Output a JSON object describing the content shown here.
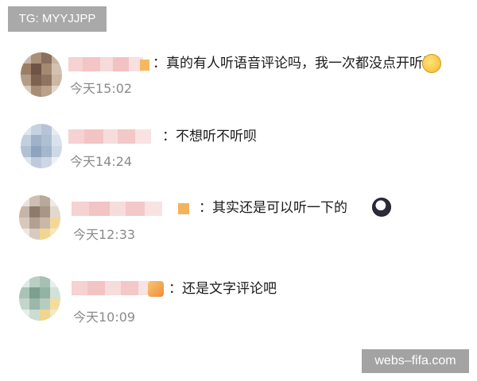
{
  "tag": {
    "text": "TG: MYYJJPP"
  },
  "watermark": {
    "text": "webs–fifa.com"
  },
  "comments": [
    {
      "text": "：真的有人听语音评论吗，我一次都没点开听过",
      "time": "今天15:02",
      "emoji": "laughing-crying-emoji-icon"
    },
    {
      "text": "：不想听不听呗",
      "time": "今天14:24",
      "emoji": ""
    },
    {
      "text": "：其实还是可以听一下的",
      "time": "今天12:33",
      "emoji": "panda-emoji-icon"
    },
    {
      "text": "：还是文字评论吧",
      "time": "今天10:09",
      "emoji": ""
    }
  ]
}
